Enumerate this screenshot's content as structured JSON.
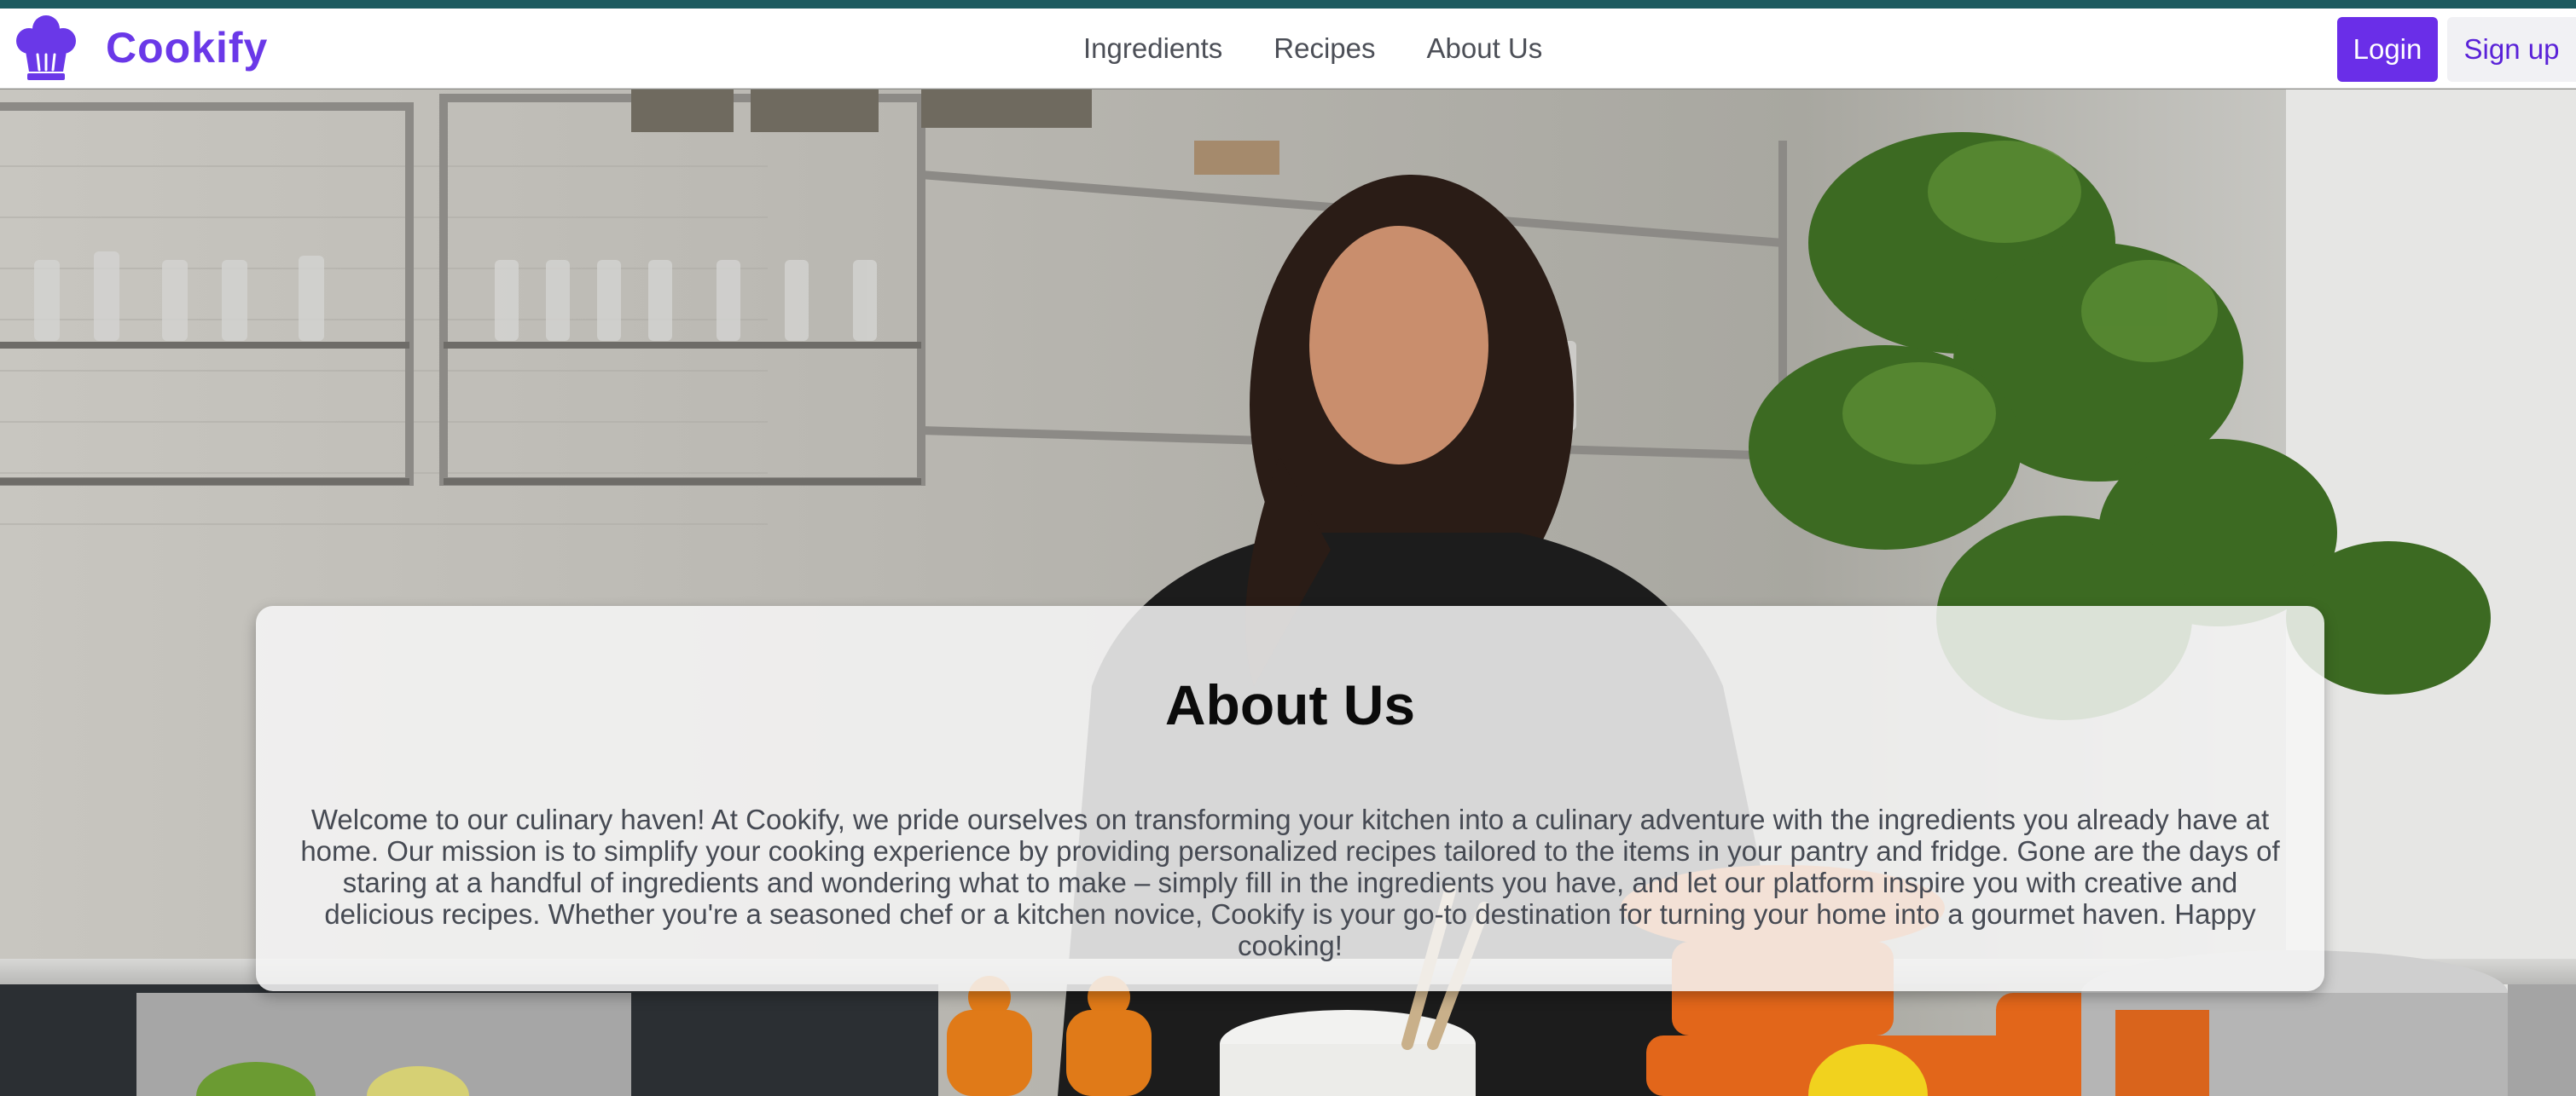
{
  "colors": {
    "topbar": "#1d5a5f",
    "brand": "#6a38e8",
    "login_bg": "#6a2ee8",
    "signup_text": "#5a22d8",
    "nav_text": "#4c4f57"
  },
  "header": {
    "logo_icon": "chef-hat-icon",
    "brand": "Cookify"
  },
  "nav": {
    "links": [
      "Ingredients",
      "Recipes",
      "About Us"
    ]
  },
  "auth": {
    "login_label": "Login",
    "signup_label": "Sign up"
  },
  "hero": {
    "background": "kitchen-photo"
  },
  "about": {
    "title": "About Us",
    "body": "Welcome to our culinary haven! At Cookify, we pride ourselves on transforming your kitchen into a culinary adventure with the ingredients you already have at home. Our mission is to simplify your cooking experience by providing personalized recipes tailored to the items in your pantry and fridge. Gone are the days of staring at a handful of ingredients and wondering what to make – simply fill in the ingredients you have, and let our platform inspire you with creative and delicious recipes. Whether you're a seasoned chef or a kitchen novice, Cookify is your go-to destination for turning your home into a gourmet haven. Happy cooking!"
  }
}
